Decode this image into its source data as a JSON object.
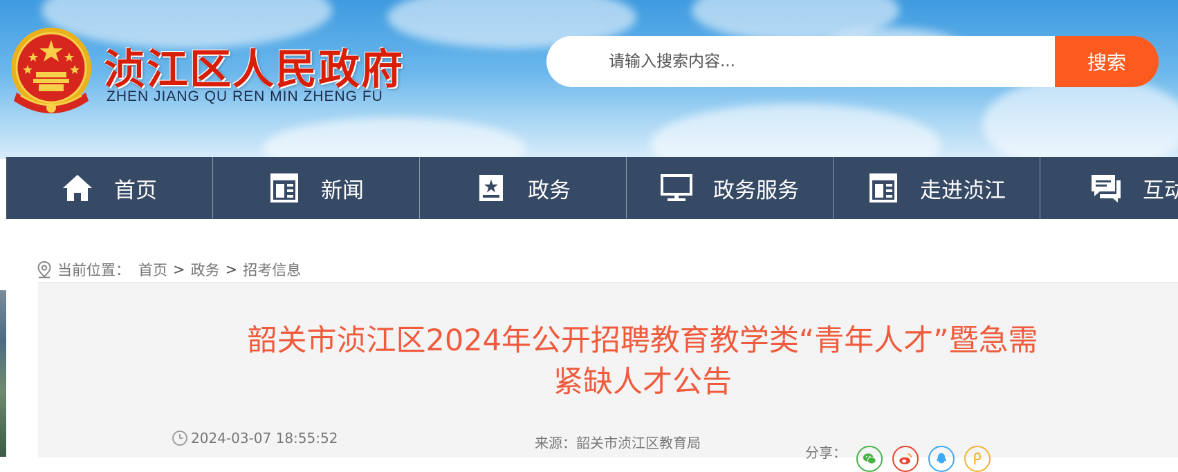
{
  "header": {
    "site_title": "浈江区人民政府",
    "site_subtitle": "ZHEN JIANG QU REN MIN ZHENG FU",
    "emblem_icon": "national-emblem-icon"
  },
  "search": {
    "placeholder": "请输入搜索内容...",
    "button_label": "搜索",
    "button_color": "#fc5a1e"
  },
  "nav": {
    "background": "#364965",
    "items": [
      {
        "label": "首页",
        "icon": "home-icon"
      },
      {
        "label": "新闻",
        "icon": "news-icon"
      },
      {
        "label": "政务",
        "icon": "government-affairs-icon"
      },
      {
        "label": "政务服务",
        "icon": "monitor-icon"
      },
      {
        "label": "走进浈江",
        "icon": "building-icon"
      },
      {
        "label": "互动",
        "icon": "chat-icon"
      }
    ]
  },
  "breadcrumb": {
    "prefix": "当前位置：",
    "items": [
      "首页",
      "政务",
      "招考信息"
    ],
    "separator": ">"
  },
  "article": {
    "title_line1": "韶关市浈江区2024年公开招聘教育教学类“青年人才”暨急需",
    "title_line2": "紧缺人才公告",
    "title_color": "#ef5b3c",
    "datetime": "2024-03-07 18:55:52",
    "source": "来源：韶关市浈江区教育局",
    "share_label": "分享：",
    "share_icons": [
      "wechat-icon",
      "weibo-icon",
      "qq-icon",
      "qzone-icon"
    ]
  }
}
